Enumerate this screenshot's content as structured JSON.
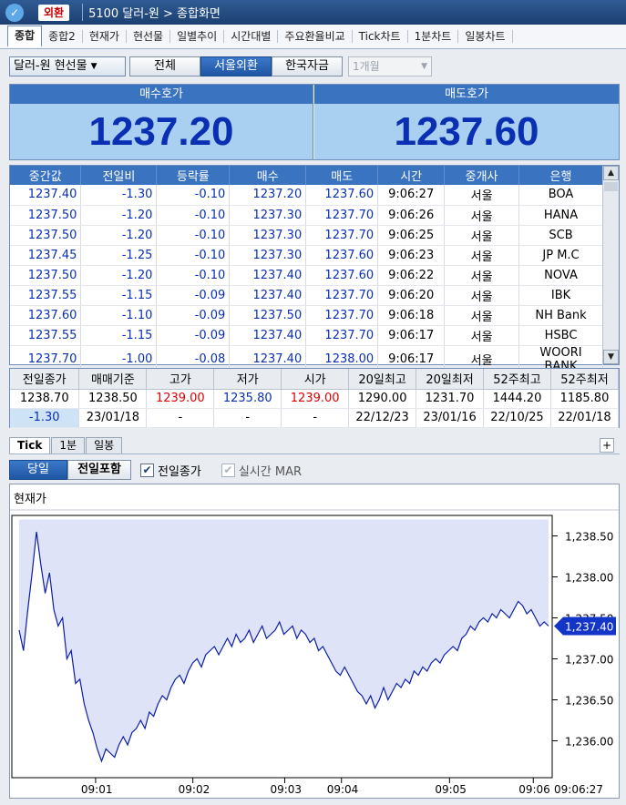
{
  "titlebar": {
    "logo": "✓",
    "tag": "외환",
    "title": "5100 달러-원 > 종합화면"
  },
  "tabs": [
    "종합",
    "종합2",
    "현재가",
    "현선물",
    "일별추이",
    "시간대별",
    "주요환율비교",
    "Tick차트",
    "1분차트",
    "일봉차트"
  ],
  "controls": {
    "product": "달러-원 현선물",
    "filters": [
      "전체",
      "서울외환",
      "한국자금"
    ],
    "active_filter": "서울외환",
    "period": "1개월"
  },
  "quote": {
    "bid_label": "매수호가",
    "bid": "1237.20",
    "ask_label": "매도호가",
    "ask": "1237.60"
  },
  "grid": {
    "headers": [
      "중간값",
      "전일비",
      "등락률",
      "매수",
      "매도",
      "시간",
      "중개사",
      "은행"
    ],
    "rows": [
      [
        "1237.40",
        "-1.30",
        "-0.10",
        "1237.20",
        "1237.60",
        "9:06:27",
        "서울",
        "BOA"
      ],
      [
        "1237.50",
        "-1.20",
        "-0.10",
        "1237.30",
        "1237.70",
        "9:06:26",
        "서울",
        "HANA"
      ],
      [
        "1237.50",
        "-1.20",
        "-0.10",
        "1237.30",
        "1237.70",
        "9:06:25",
        "서울",
        "SCB"
      ],
      [
        "1237.45",
        "-1.25",
        "-0.10",
        "1237.30",
        "1237.60",
        "9:06:23",
        "서울",
        "JP M.C"
      ],
      [
        "1237.50",
        "-1.20",
        "-0.10",
        "1237.40",
        "1237.60",
        "9:06:22",
        "서울",
        "NOVA"
      ],
      [
        "1237.55",
        "-1.15",
        "-0.09",
        "1237.40",
        "1237.70",
        "9:06:20",
        "서울",
        "IBK"
      ],
      [
        "1237.60",
        "-1.10",
        "-0.09",
        "1237.50",
        "1237.70",
        "9:06:18",
        "서울",
        "NH Bank"
      ],
      [
        "1237.55",
        "-1.15",
        "-0.09",
        "1237.40",
        "1237.70",
        "9:06:17",
        "서울",
        "HSBC"
      ],
      [
        "1237.70",
        "-1.00",
        "-0.08",
        "1237.40",
        "1238.00",
        "9:06:17",
        "서울",
        "WOORI BANK"
      ]
    ]
  },
  "stats": {
    "headers": [
      "전일종가",
      "매매기준",
      "고가",
      "저가",
      "시가",
      "20일최고",
      "20일최저",
      "52주최고",
      "52주최저"
    ],
    "row1": [
      "1238.70",
      "1238.50",
      "1239.00",
      "1235.80",
      "1239.00",
      "1290.00",
      "1231.70",
      "1444.20",
      "1185.80"
    ],
    "row2": [
      "-1.30",
      "23/01/18",
      "-",
      "-",
      "-",
      "22/12/23",
      "23/01/16",
      "22/10/25",
      "22/01/18"
    ]
  },
  "chart_tabs": [
    "Tick",
    "1분",
    "일봉"
  ],
  "chart_options": {
    "today": "당일",
    "include_prev": "전일포함",
    "prev_close_label": "전일종가",
    "realtime_label": "실시간 MAR"
  },
  "chart_data": {
    "type": "area",
    "title": "현재가",
    "yticks": [
      "1,238.50",
      "1,238.00",
      "1,237.50",
      "1,237.00",
      "1,236.50",
      "1,236.00"
    ],
    "ylim": [
      1235.55,
      1238.75
    ],
    "xticks": [
      "09:01",
      "09:02",
      "09:03",
      "09:04",
      "09:05",
      "09:06"
    ],
    "x_end_label": "09:06:27",
    "last_price": "1,237.40",
    "prev_close": 1238.7,
    "values": [
      1237.35,
      1237.1,
      1237.6,
      1238.05,
      1238.55,
      1238.15,
      1237.8,
      1238.05,
      1237.6,
      1237.4,
      1237.5,
      1237.0,
      1237.1,
      1236.7,
      1236.75,
      1236.45,
      1236.25,
      1236.1,
      1235.9,
      1235.75,
      1235.9,
      1235.85,
      1235.8,
      1235.95,
      1236.05,
      1235.95,
      1236.1,
      1236.15,
      1236.25,
      1236.15,
      1236.35,
      1236.3,
      1236.45,
      1236.55,
      1236.5,
      1236.65,
      1236.75,
      1236.8,
      1236.7,
      1236.85,
      1236.95,
      1237.0,
      1236.9,
      1237.05,
      1237.1,
      1237.15,
      1237.05,
      1237.15,
      1237.25,
      1237.15,
      1237.3,
      1237.2,
      1237.25,
      1237.35,
      1237.2,
      1237.3,
      1237.4,
      1237.25,
      1237.3,
      1237.35,
      1237.45,
      1237.3,
      1237.35,
      1237.4,
      1237.25,
      1237.35,
      1237.3,
      1237.2,
      1237.25,
      1237.1,
      1237.15,
      1237.05,
      1236.95,
      1236.85,
      1236.8,
      1236.9,
      1236.8,
      1236.7,
      1236.6,
      1236.55,
      1236.45,
      1236.55,
      1236.4,
      1236.5,
      1236.65,
      1236.5,
      1236.6,
      1236.7,
      1236.65,
      1236.75,
      1236.7,
      1236.85,
      1236.8,
      1236.9,
      1236.85,
      1236.95,
      1237.0,
      1236.95,
      1237.05,
      1237.1,
      1237.15,
      1237.1,
      1237.25,
      1237.3,
      1237.4,
      1237.35,
      1237.45,
      1237.5,
      1237.45,
      1237.55,
      1237.5,
      1237.6,
      1237.55,
      1237.5,
      1237.6,
      1237.7,
      1237.65,
      1237.55,
      1237.6,
      1237.5,
      1237.4,
      1237.45,
      1237.4
    ]
  }
}
